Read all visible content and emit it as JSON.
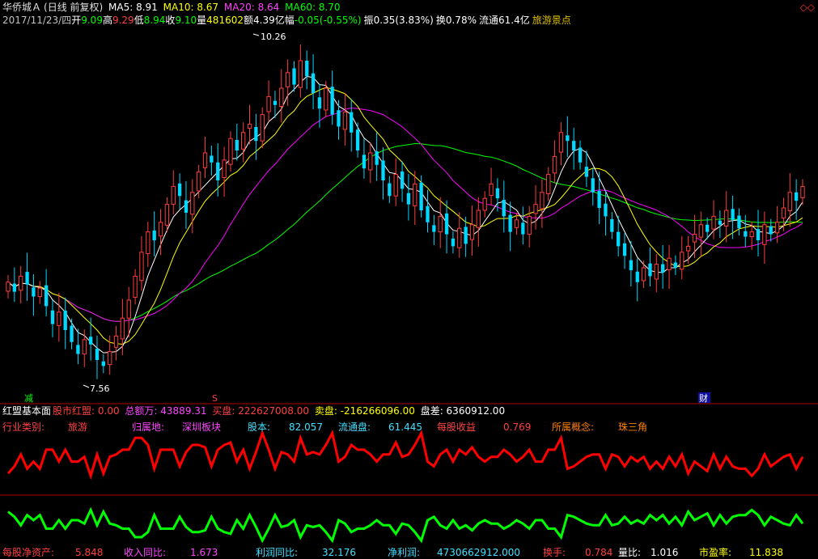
{
  "header": {
    "stock_name": "华侨城Ａ",
    "chart_mode": "(日线 前复权)",
    "ma5_label": "MA5: 8.91",
    "ma10_label": "MA10: 8.67",
    "ma20_label": "MA20: 8.64",
    "ma60_label": "MA60: 8.70",
    "corner_icons": "◇◇"
  },
  "quote": {
    "date": "2017/11/23/四",
    "open_label": "开",
    "open": "9.09",
    "high_label": "高",
    "high": "9.29",
    "low_label": "低",
    "low": "8.94",
    "close_label": "收",
    "close": "9.10",
    "volume_label": "量",
    "volume": "481602",
    "amount_label": "额",
    "amount": "4.39亿",
    "change_label": "幅",
    "change": "-0.05(-0.55%)",
    "amplitude_label": "振",
    "amplitude": "0.35(3.83%)",
    "turnover_label": "换",
    "turnover": "0.78%",
    "float_label": "流通",
    "float_value": "61.4亿",
    "concept": "旅游景点"
  },
  "annotations": {
    "peak_label": "10.26",
    "low_label": "7.56",
    "marker_reduce": "减",
    "marker_s": "S",
    "marker_finance": "财"
  },
  "indicator_header": {
    "title": "红盟基本面",
    "item1": "股市红盟: 0.00",
    "item2": "总额万: 43889.31",
    "item3": "买盘: 222627008.00",
    "item4": "卖盘: -216266096.00",
    "item5": "盘差: 6360912.00"
  },
  "fundamentals_row1": {
    "industry_label": "行业类别:",
    "industry": "旅游",
    "region_label": "归属地:",
    "region": "深圳板块",
    "share_capital_label": "股本:",
    "share_capital": "82.057",
    "float_shares_label": "流通盘:",
    "float_shares": "61.445",
    "eps_label": "每股收益",
    "eps": "0.769",
    "concept_label": "所属概念:",
    "concept": "珠三角"
  },
  "fundamentals_row2": {
    "bvps_label": "每股净资产:",
    "bvps": "5.848",
    "revenue_yoy_label": "收入同比:",
    "revenue_yoy": "1.673",
    "profit_yoy_label": "利润同比:",
    "profit_yoy": "32.176",
    "net_profit_label": "净利润:",
    "net_profit": "4730662912.000",
    "turnover_label": "换手:",
    "turnover": "0.784",
    "volume_ratio_label": "量比:",
    "volume_ratio": "1.016",
    "pe_label": "市盈率:",
    "pe": "11.838"
  },
  "colors": {
    "up": "#ff3c3c",
    "down": "#00d8ff",
    "ma5": "#ffffff",
    "ma10": "#ffff00",
    "ma20": "#ff00ff",
    "ma60": "#00ff00",
    "separator": "#b00000",
    "indicator_red": "#ff0000",
    "indicator_green": "#00ff00"
  },
  "chart_data": {
    "type": "candlestick",
    "ylim": [
      7.4,
      10.4
    ],
    "peak": 10.26,
    "trough": 7.56,
    "candles_close": [
      8.3,
      8.22,
      8.35,
      8.28,
      8.18,
      8.25,
      8.1,
      7.95,
      8.05,
      7.9,
      7.8,
      7.7,
      7.82,
      7.78,
      7.65,
      7.6,
      7.72,
      7.85,
      8.0,
      8.15,
      8.35,
      8.55,
      8.72,
      8.65,
      8.8,
      8.95,
      9.1,
      9.02,
      8.88,
      9.05,
      9.22,
      9.38,
      9.3,
      9.15,
      9.32,
      9.5,
      9.4,
      9.55,
      9.62,
      9.48,
      9.7,
      9.85,
      9.78,
      9.92,
      10.05,
      9.95,
      10.15,
      10.02,
      9.88,
      9.75,
      9.92,
      9.7,
      9.6,
      9.72,
      9.55,
      9.4,
      9.25,
      9.38,
      9.28,
      9.15,
      9.02,
      9.2,
      9.08,
      8.95,
      9.12,
      8.9,
      8.8,
      8.72,
      8.85,
      8.7,
      8.6,
      8.75,
      8.62,
      8.78,
      8.9,
      9.0,
      9.12,
      9.0,
      8.85,
      8.72,
      8.82,
      8.7,
      8.85,
      8.95,
      9.05,
      9.2,
      9.35,
      9.55,
      9.48,
      9.4,
      9.3,
      9.18,
      9.05,
      8.92,
      8.85,
      8.72,
      8.6,
      8.52,
      8.4,
      8.3,
      8.42,
      8.35,
      8.45,
      8.38,
      8.5,
      8.42,
      8.55,
      8.6,
      8.7,
      8.78,
      8.72,
      8.85,
      8.78,
      8.9,
      8.82,
      8.75,
      8.68,
      8.72,
      8.65,
      8.78,
      8.7,
      8.8,
      8.92,
      9.05,
      8.98,
      9.1
    ]
  }
}
